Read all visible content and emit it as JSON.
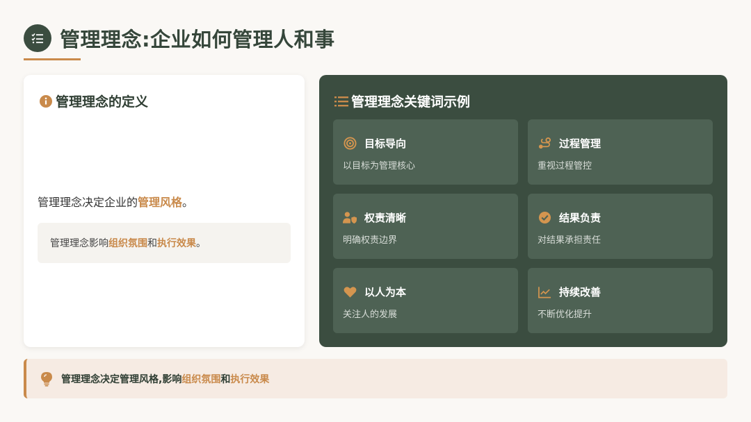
{
  "header": {
    "title": "管理理念:企业如何管理人和事"
  },
  "left_card": {
    "heading": "管理理念的定义",
    "definition_prefix": "管理理念决定企业的",
    "definition_highlight": "管理风格",
    "definition_suffix": "。",
    "influence_prefix": "管理理念影响",
    "influence_h1": "组织氛围",
    "influence_mid": "和",
    "influence_h2": "执行效果",
    "influence_suffix": "。"
  },
  "right_card": {
    "heading": "管理理念关键词示例",
    "keywords": [
      {
        "icon": "target-icon",
        "title": "目标导向",
        "desc": "以目标为管理核心"
      },
      {
        "icon": "route-icon",
        "title": "过程管理",
        "desc": "重视过程管控"
      },
      {
        "icon": "user-shield-icon",
        "title": "权责清晰",
        "desc": "明确权责边界"
      },
      {
        "icon": "check-circle-icon",
        "title": "结果负责",
        "desc": "对结果承担责任"
      },
      {
        "icon": "heart-icon",
        "title": "以人为本",
        "desc": "关注人的发展"
      },
      {
        "icon": "chart-line-icon",
        "title": "持续改善",
        "desc": "不断优化提升"
      }
    ]
  },
  "summary": {
    "prefix": "管理理念决定管理风格,影响",
    "h1": "组织氛围",
    "mid": "和",
    "h2": "执行效果"
  },
  "colors": {
    "accent": "#c98a4b",
    "dark_green": "#3b4d40",
    "tile_green": "#4e6254"
  }
}
